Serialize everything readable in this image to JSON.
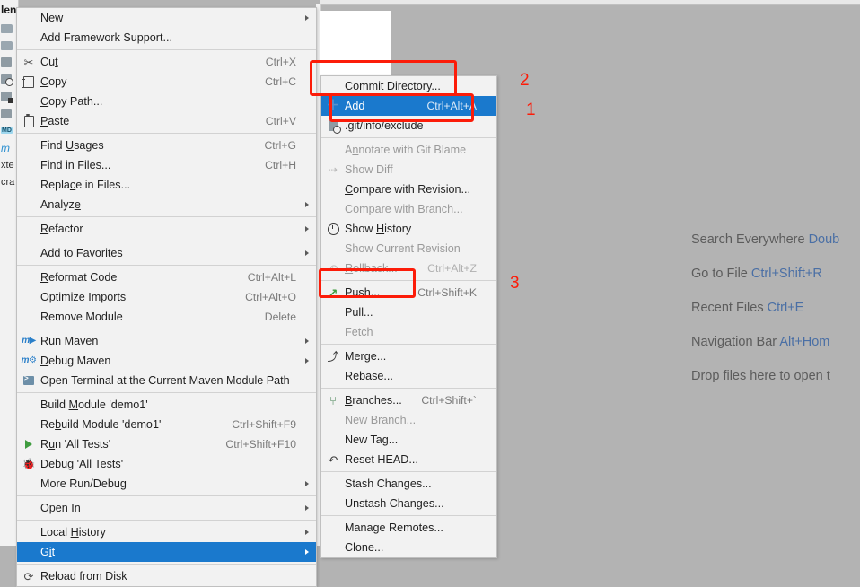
{
  "app": {
    "background_color": "#b3b3b3",
    "menu_background": "#f2f2f2",
    "selection_color": "#1a79cd",
    "annotation_color": "#fc1c09"
  },
  "project_tree": {
    "title_fragment": "len",
    "rows": [
      {
        "icon": "folder-icon",
        "label": ""
      },
      {
        "icon": "folder-icon",
        "label": ""
      },
      {
        "icon": "module-icon",
        "label": ""
      },
      {
        "icon": "excluded-folder-icon",
        "label": ""
      },
      {
        "icon": "file-icon",
        "label": ""
      },
      {
        "icon": "file-icon",
        "label": ""
      },
      {
        "icon": "markdown-icon",
        "label": "MD"
      },
      {
        "icon": "maven-icon",
        "label": "m"
      },
      {
        "icon": "none",
        "label": "xte"
      },
      {
        "icon": "none",
        "label": "cra"
      }
    ]
  },
  "hints": {
    "lines": [
      {
        "label": "Search Everywhere ",
        "key": "Doub"
      },
      {
        "label": "Go to File ",
        "key": "Ctrl+Shift+R"
      },
      {
        "label": "Recent Files ",
        "key": "Ctrl+E"
      },
      {
        "label": "Navigation Bar ",
        "key": "Alt+Hom"
      },
      {
        "label": "Drop files here to open t",
        "key": ""
      }
    ]
  },
  "context_menu": {
    "name": "project-context-menu",
    "items": [
      {
        "type": "item",
        "icon": "none",
        "label": "New",
        "mnemonic": "",
        "accel": "",
        "submenu": true,
        "state": "normal"
      },
      {
        "type": "item",
        "icon": "none",
        "label": "Add Framework Support...",
        "accel": "",
        "submenu": false,
        "state": "normal"
      },
      {
        "type": "separator"
      },
      {
        "type": "item",
        "icon": "scissors-icon",
        "label": "Cut",
        "accel": "Ctrl+X",
        "submenu": false,
        "state": "normal"
      },
      {
        "type": "item",
        "icon": "copy-icon",
        "label": "Copy",
        "accel": "Ctrl+C",
        "submenu": false,
        "state": "normal"
      },
      {
        "type": "item",
        "icon": "none",
        "label": "Copy Path...",
        "accel": "",
        "submenu": false,
        "state": "normal"
      },
      {
        "type": "item",
        "icon": "paste-icon",
        "label": "Paste",
        "accel": "Ctrl+V",
        "submenu": false,
        "state": "normal"
      },
      {
        "type": "separator"
      },
      {
        "type": "item",
        "icon": "none",
        "label": "Find Usages",
        "accel": "Ctrl+G",
        "submenu": false,
        "state": "normal"
      },
      {
        "type": "item",
        "icon": "none",
        "label": "Find in Files...",
        "accel": "Ctrl+H",
        "submenu": false,
        "state": "normal"
      },
      {
        "type": "item",
        "icon": "none",
        "label": "Replace in Files...",
        "accel": "",
        "submenu": false,
        "state": "normal"
      },
      {
        "type": "item",
        "icon": "none",
        "label": "Analyze",
        "accel": "",
        "submenu": true,
        "state": "normal"
      },
      {
        "type": "separator"
      },
      {
        "type": "item",
        "icon": "none",
        "label": "Refactor",
        "accel": "",
        "submenu": true,
        "state": "normal"
      },
      {
        "type": "separator"
      },
      {
        "type": "item",
        "icon": "none",
        "label": "Add to Favorites",
        "accel": "",
        "submenu": true,
        "state": "normal"
      },
      {
        "type": "separator"
      },
      {
        "type": "item",
        "icon": "none",
        "label": "Reformat Code",
        "accel": "Ctrl+Alt+L",
        "submenu": false,
        "state": "normal"
      },
      {
        "type": "item",
        "icon": "none",
        "label": "Optimize Imports",
        "accel": "Ctrl+Alt+O",
        "submenu": false,
        "state": "normal"
      },
      {
        "type": "item",
        "icon": "none",
        "label": "Remove Module",
        "accel": "Delete",
        "submenu": false,
        "state": "normal"
      },
      {
        "type": "separator"
      },
      {
        "type": "item",
        "icon": "maven-icon",
        "label": "Run Maven",
        "accel": "",
        "submenu": true,
        "state": "normal"
      },
      {
        "type": "item",
        "icon": "maven-debug-icon",
        "label": "Debug Maven",
        "accel": "",
        "submenu": true,
        "state": "normal"
      },
      {
        "type": "item",
        "icon": "terminal-icon",
        "label": "Open Terminal at the Current Maven Module Path",
        "accel": "",
        "submenu": false,
        "state": "normal"
      },
      {
        "type": "separator"
      },
      {
        "type": "item",
        "icon": "none",
        "label": "Build Module 'demo1'",
        "accel": "",
        "submenu": false,
        "state": "normal"
      },
      {
        "type": "item",
        "icon": "none",
        "label": "Rebuild Module 'demo1'",
        "accel": "Ctrl+Shift+F9",
        "submenu": false,
        "state": "normal"
      },
      {
        "type": "item",
        "icon": "run-icon",
        "label": "Run 'All Tests'",
        "accel": "Ctrl+Shift+F10",
        "submenu": false,
        "state": "normal"
      },
      {
        "type": "item",
        "icon": "debug-icon",
        "label": "Debug 'All Tests'",
        "accel": "",
        "submenu": false,
        "state": "normal"
      },
      {
        "type": "item",
        "icon": "none",
        "label": "More Run/Debug",
        "accel": "",
        "submenu": true,
        "state": "normal"
      },
      {
        "type": "separator"
      },
      {
        "type": "item",
        "icon": "none",
        "label": "Open In",
        "accel": "",
        "submenu": true,
        "state": "normal"
      },
      {
        "type": "separator"
      },
      {
        "type": "item",
        "icon": "none",
        "label": "Local History",
        "accel": "",
        "submenu": true,
        "state": "normal"
      },
      {
        "type": "item",
        "icon": "none",
        "label": "Git",
        "accel": "",
        "submenu": true,
        "state": "selected"
      },
      {
        "type": "separator"
      },
      {
        "type": "item",
        "icon": "reload-icon",
        "label": "Reload from Disk",
        "accel": "",
        "submenu": false,
        "state": "normal"
      }
    ]
  },
  "git_submenu": {
    "name": "git-submenu",
    "items": [
      {
        "type": "item",
        "icon": "none",
        "label": "Commit Directory...",
        "accel": "",
        "submenu": false,
        "state": "normal"
      },
      {
        "type": "item",
        "icon": "plus-icon",
        "label": "Add",
        "accel": "Ctrl+Alt+A",
        "submenu": false,
        "state": "selected"
      },
      {
        "type": "item",
        "icon": "exclude-icon",
        "label": ".git/info/exclude",
        "accel": "",
        "submenu": false,
        "state": "normal"
      },
      {
        "type": "separator"
      },
      {
        "type": "item",
        "icon": "none",
        "label": "Annotate with Git Blame",
        "accel": "",
        "submenu": false,
        "state": "disabled"
      },
      {
        "type": "item",
        "icon": "diff-icon",
        "label": "Show Diff",
        "accel": "",
        "submenu": false,
        "state": "disabled"
      },
      {
        "type": "item",
        "icon": "none",
        "label": "Compare with Revision...",
        "accel": "",
        "submenu": false,
        "state": "normal"
      },
      {
        "type": "item",
        "icon": "none",
        "label": "Compare with Branch...",
        "accel": "",
        "submenu": false,
        "state": "disabled"
      },
      {
        "type": "item",
        "icon": "clock-icon",
        "label": "Show History",
        "accel": "",
        "submenu": false,
        "state": "normal"
      },
      {
        "type": "item",
        "icon": "none",
        "label": "Show Current Revision",
        "accel": "",
        "submenu": false,
        "state": "disabled"
      },
      {
        "type": "item",
        "icon": "rollback-icon",
        "label": "Rollback...",
        "accel": "Ctrl+Alt+Z",
        "submenu": false,
        "state": "disabled"
      },
      {
        "type": "separator"
      },
      {
        "type": "item",
        "icon": "push-icon",
        "label": "Push...",
        "accel": "Ctrl+Shift+K",
        "submenu": false,
        "state": "normal"
      },
      {
        "type": "item",
        "icon": "none",
        "label": "Pull...",
        "accel": "",
        "submenu": false,
        "state": "normal"
      },
      {
        "type": "item",
        "icon": "none",
        "label": "Fetch",
        "accel": "",
        "submenu": false,
        "state": "disabled"
      },
      {
        "type": "separator"
      },
      {
        "type": "item",
        "icon": "merge-icon",
        "label": "Merge...",
        "accel": "",
        "submenu": false,
        "state": "normal"
      },
      {
        "type": "item",
        "icon": "none",
        "label": "Rebase...",
        "accel": "",
        "submenu": false,
        "state": "normal"
      },
      {
        "type": "separator"
      },
      {
        "type": "item",
        "icon": "branch-icon",
        "label": "Branches...",
        "accel": "Ctrl+Shift+`",
        "submenu": false,
        "state": "normal"
      },
      {
        "type": "item",
        "icon": "none",
        "label": "New Branch...",
        "accel": "",
        "submenu": false,
        "state": "disabled"
      },
      {
        "type": "item",
        "icon": "none",
        "label": "New Tag...",
        "accel": "",
        "submenu": false,
        "state": "normal"
      },
      {
        "type": "item",
        "icon": "reset-icon",
        "label": "Reset HEAD...",
        "accel": "",
        "submenu": false,
        "state": "normal"
      },
      {
        "type": "separator"
      },
      {
        "type": "item",
        "icon": "none",
        "label": "Stash Changes...",
        "accel": "",
        "submenu": false,
        "state": "normal"
      },
      {
        "type": "item",
        "icon": "none",
        "label": "Unstash Changes...",
        "accel": "",
        "submenu": false,
        "state": "normal"
      },
      {
        "type": "separator"
      },
      {
        "type": "item",
        "icon": "none",
        "label": "Manage Remotes...",
        "accel": "",
        "submenu": false,
        "state": "normal"
      },
      {
        "type": "item",
        "icon": "none",
        "label": "Clone...",
        "accel": "",
        "submenu": false,
        "state": "normal"
      }
    ]
  },
  "annotations": {
    "numbers": [
      {
        "id": "2",
        "text": "2"
      },
      {
        "id": "1",
        "text": "1"
      },
      {
        "id": "3",
        "text": "3"
      }
    ],
    "boxes": [
      {
        "id": "commit-directory-box",
        "target": "Commit Directory..."
      },
      {
        "id": "add-box",
        "target": "Add"
      },
      {
        "id": "push-box",
        "target": "Push..."
      }
    ]
  }
}
